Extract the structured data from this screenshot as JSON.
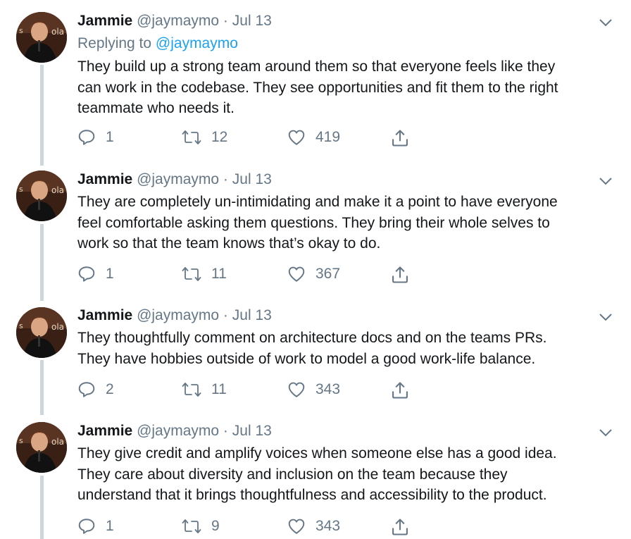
{
  "tweets": [
    {
      "name": "Jammie",
      "handle": "@jaymaymo",
      "separator": "·",
      "date": "Jul 13",
      "reply_prefix": "Replying to",
      "reply_handle": "@jaymaymo",
      "lines": [
        "They build up a strong team around them so that everyone feels like they",
        "can work in the codebase. They see opportunities and fit them to the right",
        "teammate who needs it."
      ],
      "replies": "1",
      "retweets": "12",
      "likes": "419"
    },
    {
      "name": "Jammie",
      "handle": "@jaymaymo",
      "separator": "·",
      "date": "Jul 13",
      "lines": [
        "They are completely un-intimidating and make it a point to have everyone",
        "feel comfortable asking them questions. They bring their whole selves to",
        "work so that the team knows that’s okay to do."
      ],
      "replies": "1",
      "retweets": "11",
      "likes": "367"
    },
    {
      "name": "Jammie",
      "handle": "@jaymaymo",
      "separator": "·",
      "date": "Jul 13",
      "lines": [
        "They thoughtfully comment on architecture docs and on the teams PRs.",
        "They have hobbies outside of work to model a good work-life balance."
      ],
      "replies": "2",
      "retweets": "11",
      "likes": "343"
    },
    {
      "name": "Jammie",
      "handle": "@jaymaymo",
      "separator": "·",
      "date": "Jul 13",
      "lines": [
        "They give credit and amplify voices when someone else has a good idea.",
        "They care about diversity and inclusion on the team because they",
        "understand that it brings thoughtfulness and accessibility to the product."
      ],
      "replies": "1",
      "retweets": "9",
      "likes": "343"
    }
  ],
  "icons": {
    "more": "chevron-down-icon",
    "reply": "reply-icon",
    "retweet": "retweet-icon",
    "like": "heart-icon",
    "share": "share-icon"
  },
  "colors": {
    "text": "#14171a",
    "secondary": "#657786",
    "link": "#1da1f2",
    "thread_line": "#ccd6dd"
  }
}
